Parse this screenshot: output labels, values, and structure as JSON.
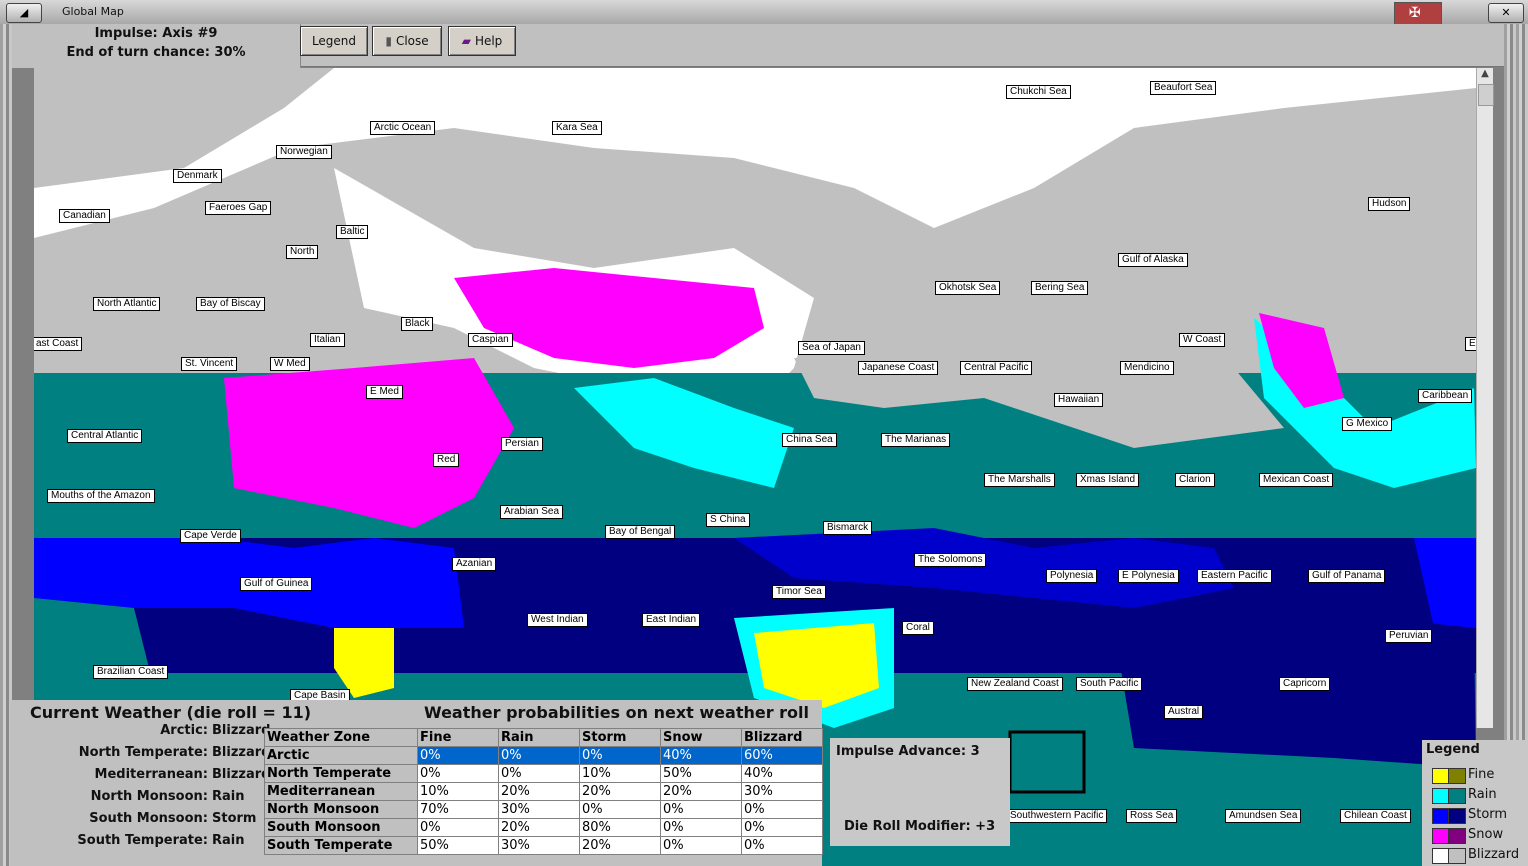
{
  "window": {
    "title": "Global Map"
  },
  "impulse": {
    "line1": "Impulse: Axis #9",
    "line2": "End of turn chance: 30%"
  },
  "toolbar": {
    "legend_label": "Legend",
    "close_label": "Close",
    "help_label": "Help"
  },
  "map_labels": [
    "Chukchi Sea",
    "Beaufort Sea",
    "Arctic Ocean",
    "Kara Sea",
    "Norwegian",
    "Denmark",
    "Faeroes Gap",
    "Canadian",
    "Baltic",
    "North",
    "Hudson",
    "Gulf of Alaska",
    "Okhotsk Sea",
    "Bering Sea",
    "North Atlantic",
    "Bay of Biscay",
    "Black",
    "Italian",
    "Caspian",
    "Sea of Japan",
    "W Coast",
    "ast Coast",
    "St. Vincent",
    "W Med",
    "Japanese Coast",
    "Central Pacific",
    "Mendicino",
    "E Med",
    "Hawaiian",
    "Caribbean",
    "Central Atlantic",
    "Persian",
    "China Sea",
    "The Marianas",
    "G Mexico",
    "Red",
    "The Marshalls",
    "Xmas Island",
    "Clarion",
    "Mexican Coast",
    "Mouths of the Amazon",
    "Arabian Sea",
    "S China",
    "Bismarck",
    "Bay of Bengal",
    "Cape Verde",
    "The Solomons",
    "Azanian",
    "Polynesia",
    "E Polynesia",
    "Eastern Pacific",
    "Gulf of Panama",
    "Gulf of Guinea",
    "Timor Sea",
    "West Indian",
    "East Indian",
    "Coral",
    "Peruvian",
    "Brazilian Coast",
    "Cape Basin",
    "New Zealand Coast",
    "South Pacific",
    "Capricorn",
    "Austral",
    "Southwestern Pacific",
    "Ross Sea",
    "Amundsen Sea",
    "Chilean Coast",
    "E"
  ],
  "current_weather": {
    "title": "Current Weather (die roll = 11)",
    "rows": [
      {
        "zone": "Arctic:",
        "value": "Blizzard"
      },
      {
        "zone": "North Temperate:",
        "value": "Blizzard"
      },
      {
        "zone": "Mediterranean:",
        "value": "Blizzard"
      },
      {
        "zone": "North Monsoon:",
        "value": "Rain"
      },
      {
        "zone": "South Monsoon:",
        "value": "Storm"
      },
      {
        "zone": "South Temperate:",
        "value": "Rain"
      }
    ]
  },
  "probabilities": {
    "title": "Weather probabilities on next weather roll",
    "headers": [
      "Weather Zone",
      "Fine",
      "Rain",
      "Storm",
      "Snow",
      "Blizzard"
    ],
    "rows": [
      [
        "Arctic",
        "0%",
        "0%",
        "0%",
        "40%",
        "60%"
      ],
      [
        "North Temperate",
        "0%",
        "0%",
        "10%",
        "50%",
        "40%"
      ],
      [
        "Mediterranean",
        "10%",
        "20%",
        "20%",
        "20%",
        "30%"
      ],
      [
        "North Monsoon",
        "70%",
        "30%",
        "0%",
        "0%",
        "0%"
      ],
      [
        "South Monsoon",
        "0%",
        "20%",
        "80%",
        "0%",
        "0%"
      ],
      [
        "South Temperate",
        "50%",
        "30%",
        "20%",
        "0%",
        "0%"
      ]
    ]
  },
  "impulse_panel": {
    "advance": "Impulse Advance:  3",
    "modifier": "Die Roll Modifier:  +3"
  },
  "legend": {
    "title": "Legend",
    "items": [
      {
        "label": "Fine",
        "c1": "#ffff00",
        "c2": "#808000"
      },
      {
        "label": "Rain",
        "c1": "#00ffff",
        "c2": "#008080"
      },
      {
        "label": "Storm",
        "c1": "#0000ff",
        "c2": "#000080"
      },
      {
        "label": "Snow",
        "c1": "#ff00ff",
        "c2": "#800080"
      },
      {
        "label": "Blizzard",
        "c1": "#ffffff",
        "c2": "#c0c0c0"
      }
    ]
  }
}
